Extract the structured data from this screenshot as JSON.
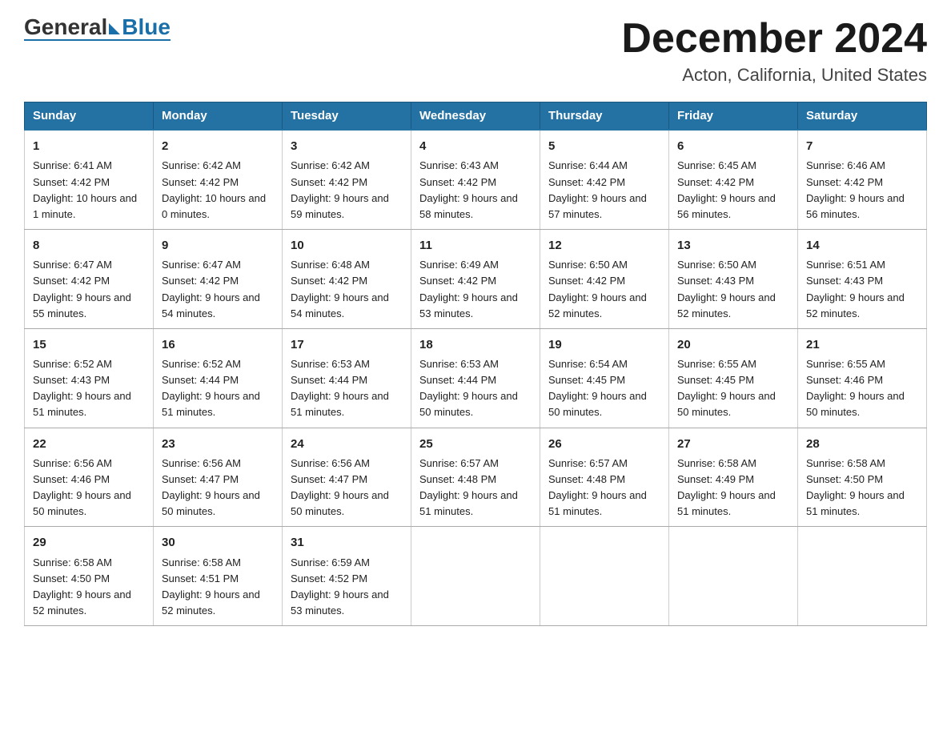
{
  "logo": {
    "general": "General",
    "blue": "Blue"
  },
  "title": "December 2024",
  "subtitle": "Acton, California, United States",
  "days": [
    "Sunday",
    "Monday",
    "Tuesday",
    "Wednesday",
    "Thursday",
    "Friday",
    "Saturday"
  ],
  "weeks": [
    [
      {
        "num": "1",
        "sunrise": "6:41 AM",
        "sunset": "4:42 PM",
        "daylight": "10 hours and 1 minute."
      },
      {
        "num": "2",
        "sunrise": "6:42 AM",
        "sunset": "4:42 PM",
        "daylight": "10 hours and 0 minutes."
      },
      {
        "num": "3",
        "sunrise": "6:42 AM",
        "sunset": "4:42 PM",
        "daylight": "9 hours and 59 minutes."
      },
      {
        "num": "4",
        "sunrise": "6:43 AM",
        "sunset": "4:42 PM",
        "daylight": "9 hours and 58 minutes."
      },
      {
        "num": "5",
        "sunrise": "6:44 AM",
        "sunset": "4:42 PM",
        "daylight": "9 hours and 57 minutes."
      },
      {
        "num": "6",
        "sunrise": "6:45 AM",
        "sunset": "4:42 PM",
        "daylight": "9 hours and 56 minutes."
      },
      {
        "num": "7",
        "sunrise": "6:46 AM",
        "sunset": "4:42 PM",
        "daylight": "9 hours and 56 minutes."
      }
    ],
    [
      {
        "num": "8",
        "sunrise": "6:47 AM",
        "sunset": "4:42 PM",
        "daylight": "9 hours and 55 minutes."
      },
      {
        "num": "9",
        "sunrise": "6:47 AM",
        "sunset": "4:42 PM",
        "daylight": "9 hours and 54 minutes."
      },
      {
        "num": "10",
        "sunrise": "6:48 AM",
        "sunset": "4:42 PM",
        "daylight": "9 hours and 54 minutes."
      },
      {
        "num": "11",
        "sunrise": "6:49 AM",
        "sunset": "4:42 PM",
        "daylight": "9 hours and 53 minutes."
      },
      {
        "num": "12",
        "sunrise": "6:50 AM",
        "sunset": "4:42 PM",
        "daylight": "9 hours and 52 minutes."
      },
      {
        "num": "13",
        "sunrise": "6:50 AM",
        "sunset": "4:43 PM",
        "daylight": "9 hours and 52 minutes."
      },
      {
        "num": "14",
        "sunrise": "6:51 AM",
        "sunset": "4:43 PM",
        "daylight": "9 hours and 52 minutes."
      }
    ],
    [
      {
        "num": "15",
        "sunrise": "6:52 AM",
        "sunset": "4:43 PM",
        "daylight": "9 hours and 51 minutes."
      },
      {
        "num": "16",
        "sunrise": "6:52 AM",
        "sunset": "4:44 PM",
        "daylight": "9 hours and 51 minutes."
      },
      {
        "num": "17",
        "sunrise": "6:53 AM",
        "sunset": "4:44 PM",
        "daylight": "9 hours and 51 minutes."
      },
      {
        "num": "18",
        "sunrise": "6:53 AM",
        "sunset": "4:44 PM",
        "daylight": "9 hours and 50 minutes."
      },
      {
        "num": "19",
        "sunrise": "6:54 AM",
        "sunset": "4:45 PM",
        "daylight": "9 hours and 50 minutes."
      },
      {
        "num": "20",
        "sunrise": "6:55 AM",
        "sunset": "4:45 PM",
        "daylight": "9 hours and 50 minutes."
      },
      {
        "num": "21",
        "sunrise": "6:55 AM",
        "sunset": "4:46 PM",
        "daylight": "9 hours and 50 minutes."
      }
    ],
    [
      {
        "num": "22",
        "sunrise": "6:56 AM",
        "sunset": "4:46 PM",
        "daylight": "9 hours and 50 minutes."
      },
      {
        "num": "23",
        "sunrise": "6:56 AM",
        "sunset": "4:47 PM",
        "daylight": "9 hours and 50 minutes."
      },
      {
        "num": "24",
        "sunrise": "6:56 AM",
        "sunset": "4:47 PM",
        "daylight": "9 hours and 50 minutes."
      },
      {
        "num": "25",
        "sunrise": "6:57 AM",
        "sunset": "4:48 PM",
        "daylight": "9 hours and 51 minutes."
      },
      {
        "num": "26",
        "sunrise": "6:57 AM",
        "sunset": "4:48 PM",
        "daylight": "9 hours and 51 minutes."
      },
      {
        "num": "27",
        "sunrise": "6:58 AM",
        "sunset": "4:49 PM",
        "daylight": "9 hours and 51 minutes."
      },
      {
        "num": "28",
        "sunrise": "6:58 AM",
        "sunset": "4:50 PM",
        "daylight": "9 hours and 51 minutes."
      }
    ],
    [
      {
        "num": "29",
        "sunrise": "6:58 AM",
        "sunset": "4:50 PM",
        "daylight": "9 hours and 52 minutes."
      },
      {
        "num": "30",
        "sunrise": "6:58 AM",
        "sunset": "4:51 PM",
        "daylight": "9 hours and 52 minutes."
      },
      {
        "num": "31",
        "sunrise": "6:59 AM",
        "sunset": "4:52 PM",
        "daylight": "9 hours and 53 minutes."
      },
      null,
      null,
      null,
      null
    ]
  ],
  "labels": {
    "sunrise": "Sunrise:",
    "sunset": "Sunset:",
    "daylight": "Daylight:"
  }
}
